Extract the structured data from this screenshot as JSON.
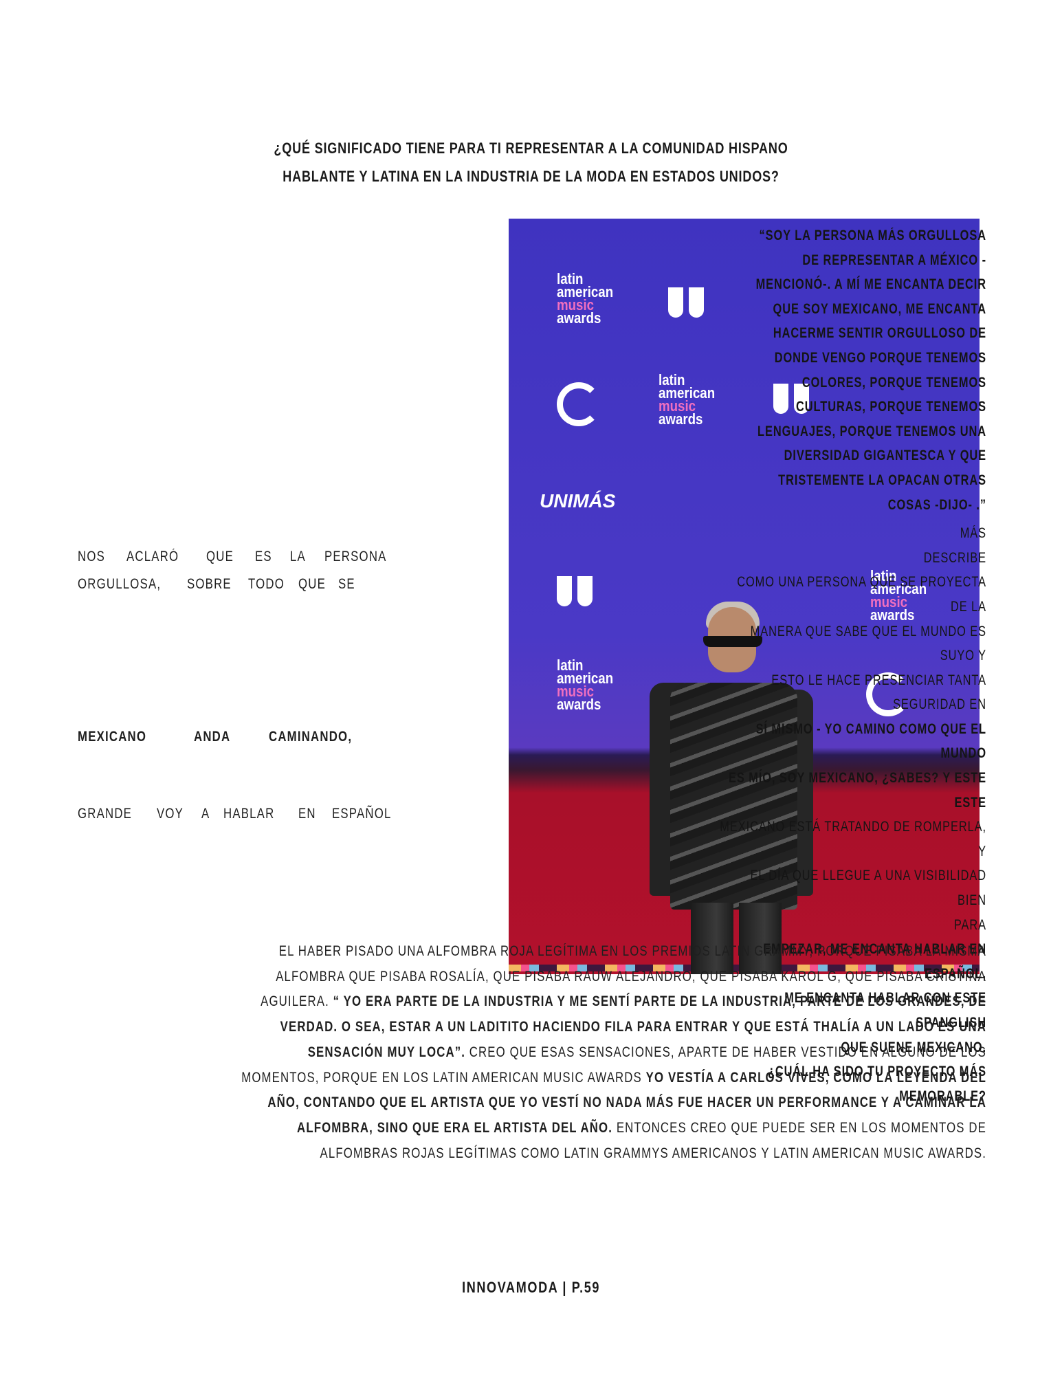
{
  "heading": {
    "line1": "¿QUÉ SIGNIFICADO TIENE PARA TI REPRESENTAR A LA COMUNIDAD HISPANO",
    "line2": "HABLANTE Y LATINA EN LA INDUSTRIA DE LA MODA EN ESTADOS UNIDOS?"
  },
  "photo": {
    "logo_latin": "latin",
    "logo_american": "american",
    "logo_music": "music",
    "logo_awards": "awards",
    "unimas": "UNIMÁS"
  },
  "right_quote": [
    "“SOY LA PERSONA MÁS ORGULLOSA",
    "DE REPRESENTAR A MÉXICO -",
    "MENCIONÓ-. A MÍ ME ENCANTA DECIR",
    "QUE SOY MEXICANO, ME ENCANTA",
    "HACERME SENTIR ORGULLOSO DE",
    "DONDE VENGO PORQUE TENEMOS",
    "COLORES, PORQUE TENEMOS",
    "CULTURAS, PORQUE TENEMOS",
    "LENGUAJES, PORQUE TENEMOS UNA",
    "DIVERSIDAD GIGANTESCA Y QUE",
    "TRISTEMENTE LA OPACAN OTRAS",
    "COSAS -DIJO- .”"
  ],
  "right_text": [
    {
      "t": "MÁS",
      "bold": false
    },
    {
      "t": "DESCRIBE",
      "bold": false
    },
    {
      "t": "COMO UNA PERSONA QUE SE PROYECTA DE LA",
      "bold": false
    },
    {
      "t": "MANERA QUE SABE QUE EL MUNDO ES SUYO Y",
      "bold": false
    },
    {
      "t": "ESTO LE HACE PRESENCIAR TANTA SEGURIDAD EN",
      "bold": false
    },
    {
      "t": "SÍ MISMO - YO CAMINO COMO QUE EL MUNDO",
      "bold": true
    },
    {
      "t": "ES MÍO, SOY MEXICANO, ¿SABES? Y ESTE",
      "bold": true
    },
    {
      "t": "ESTE",
      "bold": true
    },
    {
      "t": "MEXICANO ESTÁ TRATANDO DE ROMPERLA, Y",
      "bold": false
    },
    {
      "t": "EL DÍA QUE LLEGUE A UNA VISIBILIDAD BIEN",
      "bold": false
    },
    {
      "t": "PARA",
      "bold": false
    },
    {
      "t": "EMPEZAR, ME ENCANTA HABLAR EN ESPAÑOL,",
      "bold": true
    },
    {
      "t": "ME ENCANTA HABLAR CON ESTE SPANGLISH",
      "bold": true
    },
    {
      "t": "QUE SUENE MEXICANO.",
      "bold": true
    },
    {
      "t": "¿CUÁL HA SIDO TU PROYECTO MÁS",
      "bold": true
    },
    {
      "t": "MEMORABLE?",
      "bold": true
    }
  ],
  "left": {
    "row1": [
      "NOS",
      "ACLARÓ",
      "QUE",
      "ES",
      "LA",
      "PERSONA"
    ],
    "row2": [
      "ORGULLOSA,",
      "SOBRE",
      "TODO",
      "QUE",
      "SE"
    ],
    "row3": [
      "MEXICANO",
      "ANDA",
      "CAMINANDO,"
    ],
    "row4": [
      "GRANDE",
      "VOY",
      "A",
      "HABLAR",
      "EN",
      "ESPAÑOL"
    ]
  },
  "bottom": {
    "p1": "EL HABER PISADO UNA ALFOMBRA ROJA LEGÍTIMA EN LOS PREMIOS LATIN GRAMMY, PORQUE PISABA LA MISMA ALFOMBRA QUE PISABA ROSALÍA, QUE PISABA RAUW ALEJANDRO, QUE PISABA KAROL G, QUE PISABA CRISTINA AGUILERA. ",
    "b1": "“ YO ERA PARTE DE LA INDUSTRIA Y ME SENTÍ PARTE DE LA INDUSTRIA, PARTE DE LOS GRANDES, DE VERDAD. O SEA, ESTAR A UN LADITITO HACIENDO FILA PARA ENTRAR Y QUE ESTÁ THALÍA A UN LADO ES UNA SENSACIÓN MUY LOCA”.",
    "p2": " CREO QUE ESAS SENSACIONES, APARTE DE HABER VESTIDO EN ALGUNO DE LOS MOMENTOS, PORQUE EN LOS LATIN AMERICAN MUSIC AWARDS ",
    "b2": "YO VESTÍA A CARLOS VIVES, COMO LA LEYENDA DEL AÑO, CONTANDO QUE EL ARTISTA QUE YO VESTÍ NO NADA MÁS FUE HACER UN PERFORMANCE Y A CAMINAR LA ALFOMBRA, SINO QUE ERA EL ARTISTA DEL AÑO.",
    "p3": " ENTONCES CREO QUE PUEDE SER EN LOS MOMENTOS DE ALFOMBRAS ROJAS LEGÍTIMAS COMO LATIN GRAMMYS AMERICANOS Y LATIN AMERICAN MUSIC AWARDS."
  },
  "footer": "INNOVAMODA | P.59"
}
